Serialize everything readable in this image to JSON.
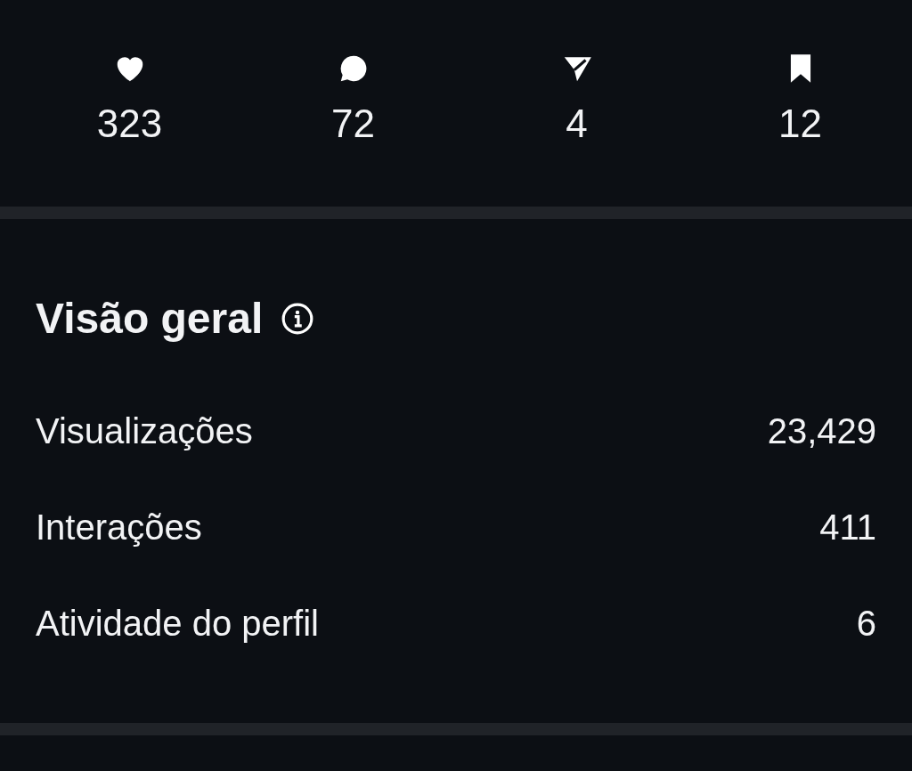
{
  "stats": [
    {
      "kind": "heart",
      "count": "323"
    },
    {
      "kind": "comment",
      "count": "72"
    },
    {
      "kind": "share",
      "count": "4"
    },
    {
      "kind": "save",
      "count": "12"
    }
  ],
  "overview": {
    "title": "Visão geral",
    "rows": [
      {
        "label": "Visualizações",
        "value": "23,429"
      },
      {
        "label": "Interações",
        "value": "411"
      },
      {
        "label": "Atividade do perfil",
        "value": "6"
      }
    ]
  }
}
